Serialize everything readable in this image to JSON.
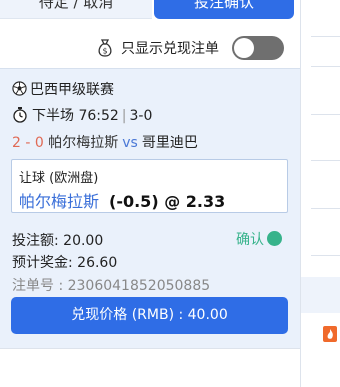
{
  "tabs": {
    "pending_label": "待定 / 取消",
    "confirmed_label": "投注确认"
  },
  "filter": {
    "icon": "money-bag-icon",
    "label": "只显示兑现注单",
    "toggle_on": false
  },
  "bet": {
    "league": "巴西甲级联赛",
    "period": "下半场 76:52",
    "live_score": "3-0",
    "bet_score": "2 - 0",
    "home_team": "帕尔梅拉斯",
    "vs": "vs",
    "away_team": "哥里迪巴",
    "market": "让球 (欧洲盘)",
    "selection_team": "帕尔梅拉斯",
    "selection_odds": "(-0.5) @ 2.33",
    "stake_label": "投注额: 20.00",
    "payout_label": "预计奖金: 26.60",
    "ticket_label": "注单号 : 2306041852050885",
    "status": "确认",
    "cashout_button": "兑现价格 (RMB) : 40.00"
  },
  "colors": {
    "accent": "#2f6de6",
    "status_green": "#37b38b",
    "score_red": "#e06a55",
    "card_bg": "#eaf1fb"
  }
}
